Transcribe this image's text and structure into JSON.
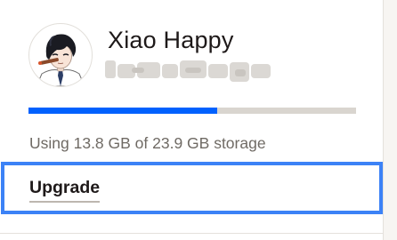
{
  "account": {
    "name": "Xiao Happy",
    "avatar_icon": "anime-avatar-icon",
    "email_obscured": true
  },
  "storage": {
    "used_gb": 13.8,
    "total_gb": 23.9,
    "usage_text": "Using 13.8 GB of 23.9 GB storage",
    "fill_color": "#0061fe",
    "track_color": "#d9d5cf"
  },
  "actions": {
    "upgrade_label": "Upgrade",
    "focus_color": "#3c82f6"
  }
}
